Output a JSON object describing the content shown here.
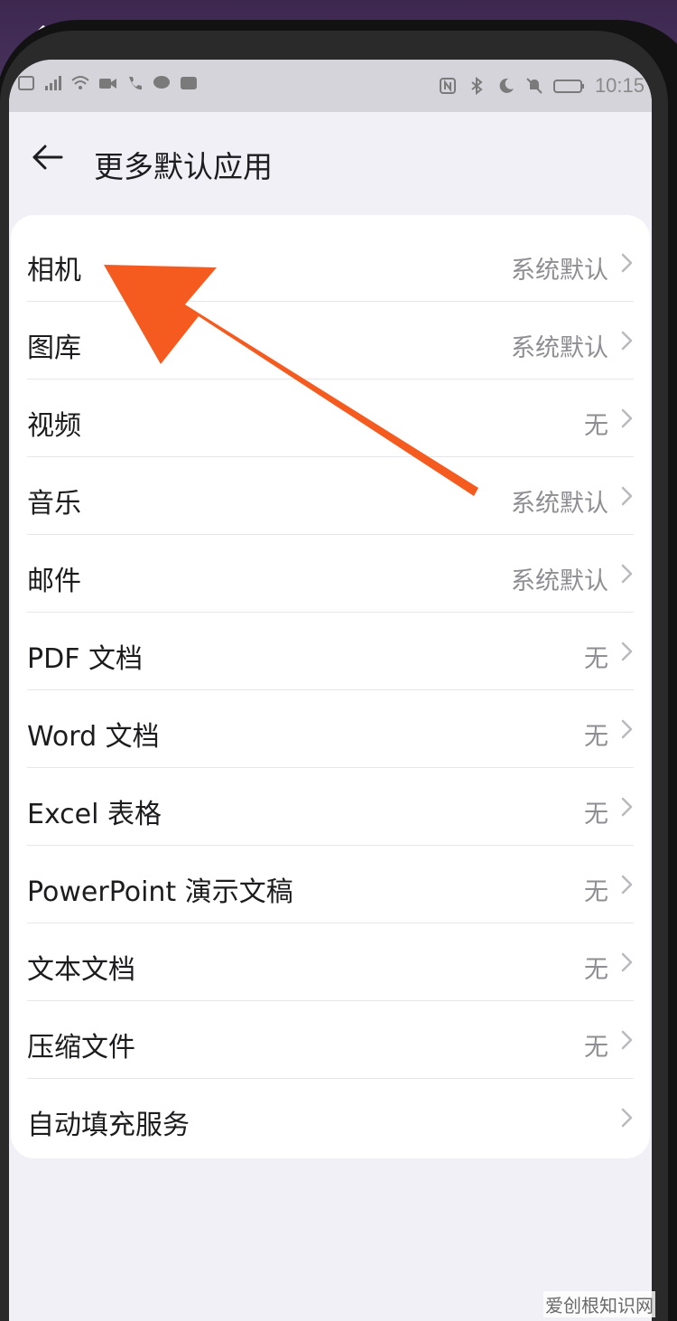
{
  "header": {
    "title": "更多默认应用"
  },
  "status": {
    "time": "10:15"
  },
  "rows": [
    {
      "label": "相机",
      "value": "系统默认"
    },
    {
      "label": "图库",
      "value": "系统默认"
    },
    {
      "label": "视频",
      "value": "无"
    },
    {
      "label": "音乐",
      "value": "系统默认"
    },
    {
      "label": "邮件",
      "value": "系统默认"
    },
    {
      "label": "PDF 文档",
      "value": "无"
    },
    {
      "label": "Word 文档",
      "value": "无"
    },
    {
      "label": "Excel 表格",
      "value": "无"
    },
    {
      "label": "PowerPoint 演示文稿",
      "value": "无"
    },
    {
      "label": "文本文档",
      "value": "无"
    },
    {
      "label": "压缩文件",
      "value": "无"
    },
    {
      "label": "自动填充服务",
      "value": ""
    }
  ],
  "annotation": {
    "arrow_color": "#f55a1e"
  },
  "watermark": "爱创根知识网",
  "colors": {
    "background": "#f1f0f6",
    "card": "#ffffff",
    "value_text": "#8e8e93"
  }
}
